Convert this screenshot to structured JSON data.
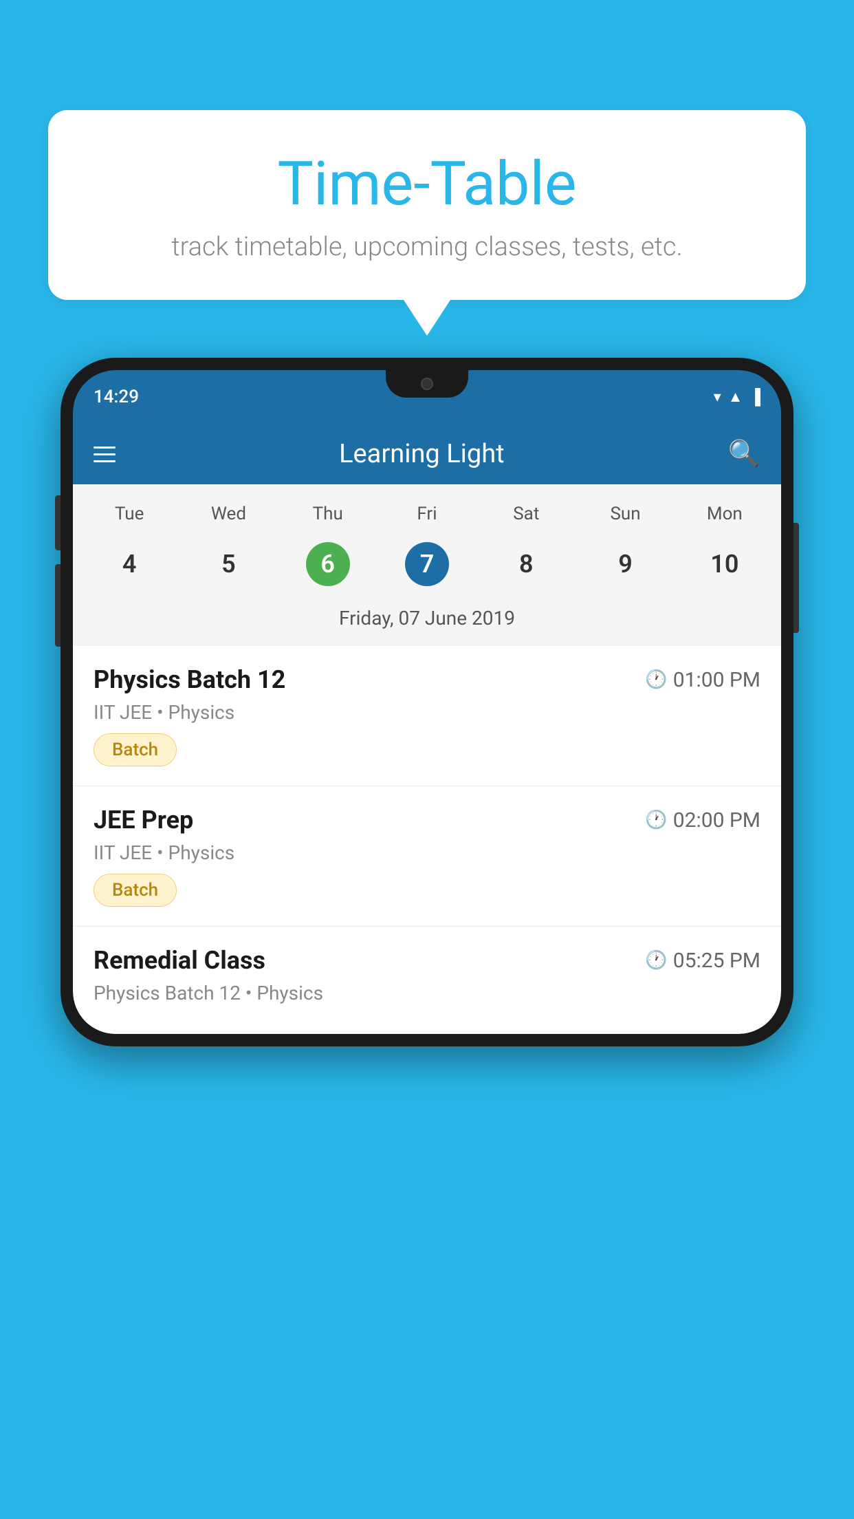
{
  "background_color": "#29b6e8",
  "speech_bubble": {
    "title": "Time-Table",
    "subtitle": "track timetable, upcoming classes, tests, etc."
  },
  "phone": {
    "status_bar": {
      "time": "14:29"
    },
    "app_bar": {
      "title": "Learning Light"
    },
    "calendar": {
      "day_labels": [
        "Tue",
        "Wed",
        "Thu",
        "Fri",
        "Sat",
        "Sun",
        "Mon"
      ],
      "day_numbers": [
        "4",
        "5",
        "6",
        "7",
        "8",
        "9",
        "10"
      ],
      "today_index": 2,
      "selected_index": 3,
      "selected_date_label": "Friday, 07 June 2019"
    },
    "schedule": [
      {
        "title": "Physics Batch 12",
        "time": "01:00 PM",
        "subtitle": "IIT JEE • Physics",
        "badge": "Batch"
      },
      {
        "title": "JEE Prep",
        "time": "02:00 PM",
        "subtitle": "IIT JEE • Physics",
        "badge": "Batch"
      },
      {
        "title": "Remedial Class",
        "time": "05:25 PM",
        "subtitle": "Physics Batch 12 • Physics",
        "badge": ""
      }
    ]
  }
}
